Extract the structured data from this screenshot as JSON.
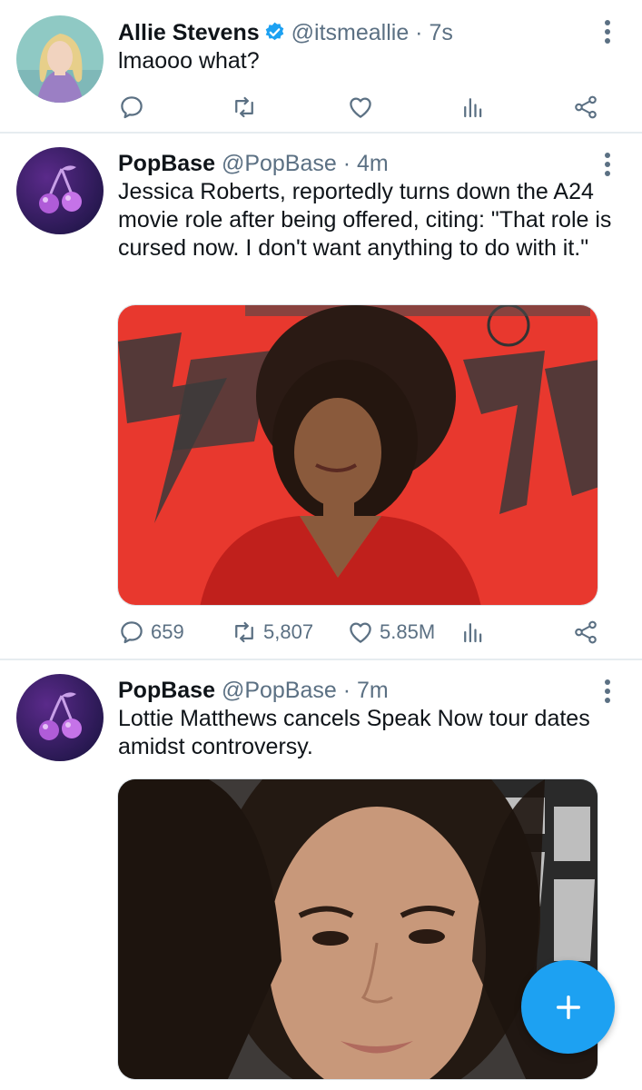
{
  "tweets": [
    {
      "name": "Allie Stevens",
      "verified": true,
      "handle": "@itsmeallie",
      "dot": "·",
      "time": "7s",
      "text": "lmaooo what?",
      "counts": {
        "reply": "",
        "retweet": "",
        "like": ""
      }
    },
    {
      "name": "PopBase",
      "verified": false,
      "handle": "@PopBase",
      "dot": "·",
      "time": "4m",
      "text": "Jessica Roberts, reportedly turns down the A24 movie role after being offered, citing: \"That role is cursed now. I don't want anything to do with it.\"",
      "counts": {
        "reply": "659",
        "retweet": "5,807",
        "like": "5.85M"
      }
    },
    {
      "name": "PopBase",
      "verified": false,
      "handle": "@PopBase",
      "dot": "·",
      "time": "7m",
      "text": "Lottie Matthews cancels Speak Now tour dates amidst controversy.",
      "counts": {
        "reply": "",
        "retweet": "",
        "like": ""
      }
    }
  ],
  "icons": {
    "reply": "reply-icon",
    "retweet": "retweet-icon",
    "like": "heart-icon",
    "analytics": "analytics-icon",
    "share": "share-icon",
    "more": "more-vertical-icon",
    "compose": "compose-plus-icon",
    "verified": "verified-badge-icon"
  },
  "colors": {
    "accent": "#1da1f2",
    "secondary_text": "#5b7083",
    "divider": "#e6ecf0"
  }
}
